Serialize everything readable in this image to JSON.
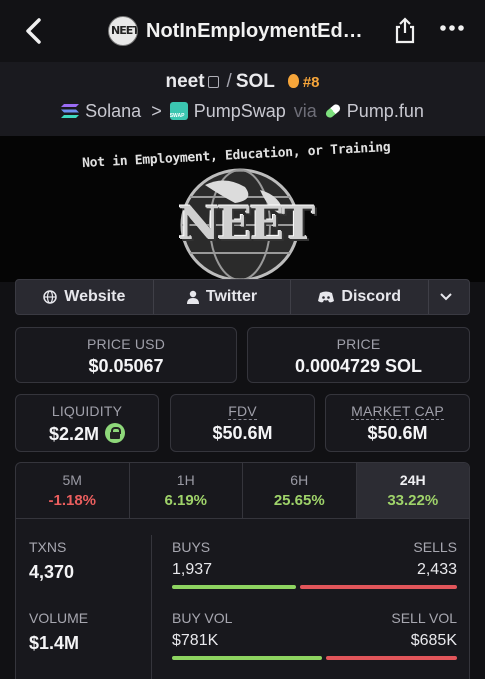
{
  "header": {
    "title": "NotInEmploymentEd…",
    "avatar_text": "NEET",
    "icons": [
      "back-arrow-icon",
      "share-icon",
      "more-icon"
    ]
  },
  "pair": {
    "base": "neet",
    "separator": "/",
    "quote": "SOL",
    "rank": "#8",
    "chain": "Solana",
    "dex": "PumpSwap",
    "via": "via",
    "launchpad": "Pump.fun"
  },
  "banner": {
    "tagline": "Not in Employment, Education, or Training",
    "logo_text": "NEET"
  },
  "links": {
    "website": "Website",
    "twitter": "Twitter",
    "discord": "Discord"
  },
  "metrics": {
    "price_usd_label": "PRICE USD",
    "price_usd": "$0.05067",
    "price_label": "PRICE",
    "price_sol": "0.0004729 SOL",
    "liquidity_label": "LIQUIDITY",
    "liquidity": "$2.2M",
    "fdv_label": "FDV",
    "fdv": "$50.6M",
    "mcap_label": "MARKET CAP",
    "mcap": "$50.6M"
  },
  "tabs": [
    {
      "label": "5M",
      "change": "-1.18%",
      "direction": "down"
    },
    {
      "label": "1H",
      "change": "6.19%",
      "direction": "up"
    },
    {
      "label": "6H",
      "change": "25.65%",
      "direction": "up"
    },
    {
      "label": "24H",
      "change": "33.22%",
      "direction": "up",
      "active": true
    }
  ],
  "txns": {
    "label": "TXNS",
    "value": "4,370",
    "buys_label": "BUYS",
    "buys": "1,937",
    "sells_label": "SELLS",
    "sells": "2,433",
    "buy_fraction": 0.443
  },
  "volume": {
    "label": "VOLUME",
    "value": "$1.4M",
    "buy_label": "BUY VOL",
    "buy": "$781K",
    "sell_label": "SELL VOL",
    "sell": "$685K",
    "buy_fraction": 0.533
  },
  "colors": {
    "positive": "#9fd36a",
    "negative": "#ea5e5e",
    "rank": "#f6a53a"
  }
}
